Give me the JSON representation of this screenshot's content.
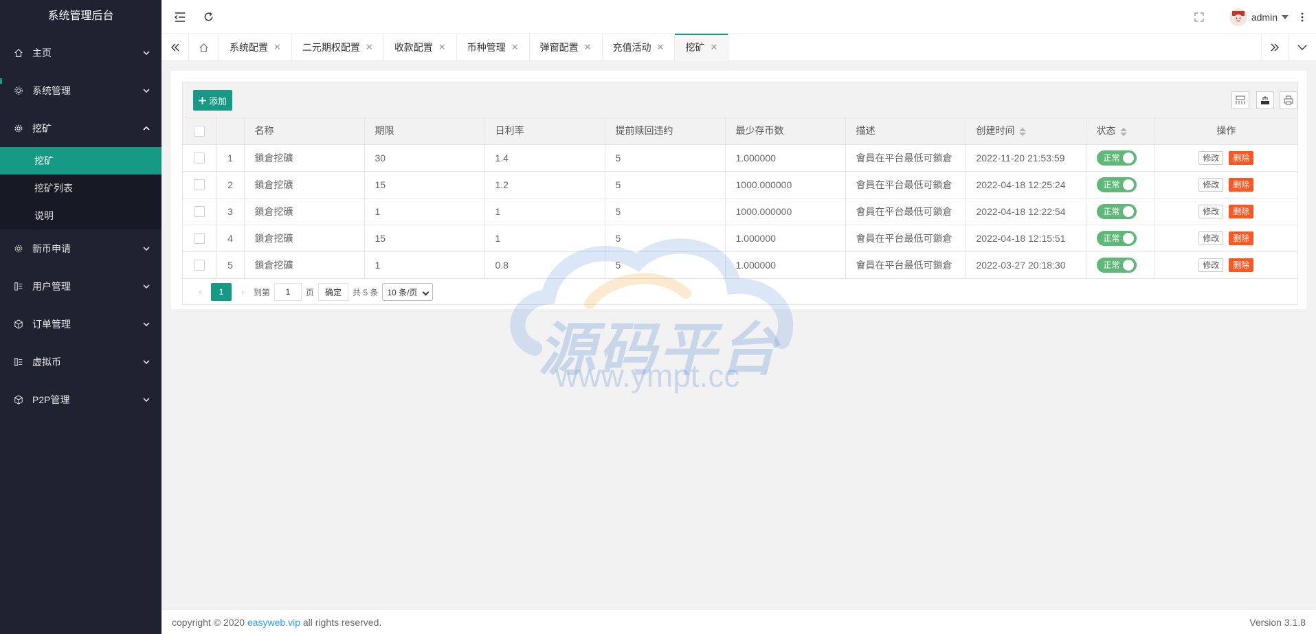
{
  "brand": "系统管理后台",
  "sidebar": {
    "items": [
      {
        "label": "主页",
        "icon": "home-icon"
      },
      {
        "label": "系统管理",
        "icon": "gear-icon"
      },
      {
        "label": "挖矿",
        "icon": "cog-icon",
        "children": [
          "挖矿",
          "挖矿列表",
          "说明"
        ],
        "active_child": 0
      },
      {
        "label": "新币申请",
        "icon": "cog-icon"
      },
      {
        "label": "用户管理",
        "icon": "user-list-icon"
      },
      {
        "label": "订单管理",
        "icon": "box-icon"
      },
      {
        "label": "虚拟币",
        "icon": "user-list-icon"
      },
      {
        "label": "P2P管理",
        "icon": "box-icon"
      }
    ]
  },
  "header": {
    "user": "admin"
  },
  "tabs": [
    {
      "label": "系统配置"
    },
    {
      "label": "二元期权配置"
    },
    {
      "label": "收款配置"
    },
    {
      "label": "币种管理"
    },
    {
      "label": "弹窗配置"
    },
    {
      "label": "充值活动"
    },
    {
      "label": "挖矿",
      "active": true
    }
  ],
  "toolbar": {
    "add_label": "添加"
  },
  "table": {
    "headers": [
      "名称",
      "期限",
      "日利率",
      "提前赎回违约",
      "最少存币数",
      "描述",
      "创建时间",
      "状态",
      "操作"
    ],
    "rows": [
      {
        "no": "1",
        "name": "鎖倉挖礦",
        "term": "30",
        "rate": "1.4",
        "penalty": "5",
        "min": "1.000000",
        "desc": "會員在平台最低可鎖倉",
        "created": "2022-11-20 21:53:59",
        "status": "正常"
      },
      {
        "no": "2",
        "name": "鎖倉挖礦",
        "term": "15",
        "rate": "1.2",
        "penalty": "5",
        "min": "1000.000000",
        "desc": "會員在平台最低可鎖倉",
        "created": "2022-04-18 12:25:24",
        "status": "正常"
      },
      {
        "no": "3",
        "name": "鎖倉挖礦",
        "term": "1",
        "rate": "1",
        "penalty": "5",
        "min": "1000.000000",
        "desc": "會員在平台最低可鎖倉",
        "created": "2022-04-18 12:22:54",
        "status": "正常"
      },
      {
        "no": "4",
        "name": "鎖倉挖礦",
        "term": "15",
        "rate": "1",
        "penalty": "5",
        "min": "1.000000",
        "desc": "會員在平台最低可鎖倉",
        "created": "2022-04-18 12:15:51",
        "status": "正常"
      },
      {
        "no": "5",
        "name": "鎖倉挖礦",
        "term": "1",
        "rate": "0.8",
        "penalty": "5",
        "min": "1.000000",
        "desc": "會員在平台最低可鎖倉",
        "created": "2022-03-27 20:18:30",
        "status": "正常"
      }
    ],
    "edit_label": "修改",
    "delete_label": "删除"
  },
  "pager": {
    "current": "1",
    "goto_label": "到第",
    "goto_value": "1",
    "page_unit": "页",
    "confirm": "确定",
    "total": "共 5 条",
    "page_size": "10 条/页"
  },
  "watermark": {
    "text": "源码平台",
    "url": "www.ympt.cc"
  },
  "footer": {
    "copyright_prefix": "copyright © 2020 ",
    "link": "easyweb.vip",
    "copyright_suffix": " all rights reserved.",
    "version": "Version 3.1.8"
  },
  "colors": {
    "sidebar_bg": "#1f2230",
    "accent": "#169985",
    "danger": "#ff5722",
    "switch_on": "#5fb878"
  }
}
